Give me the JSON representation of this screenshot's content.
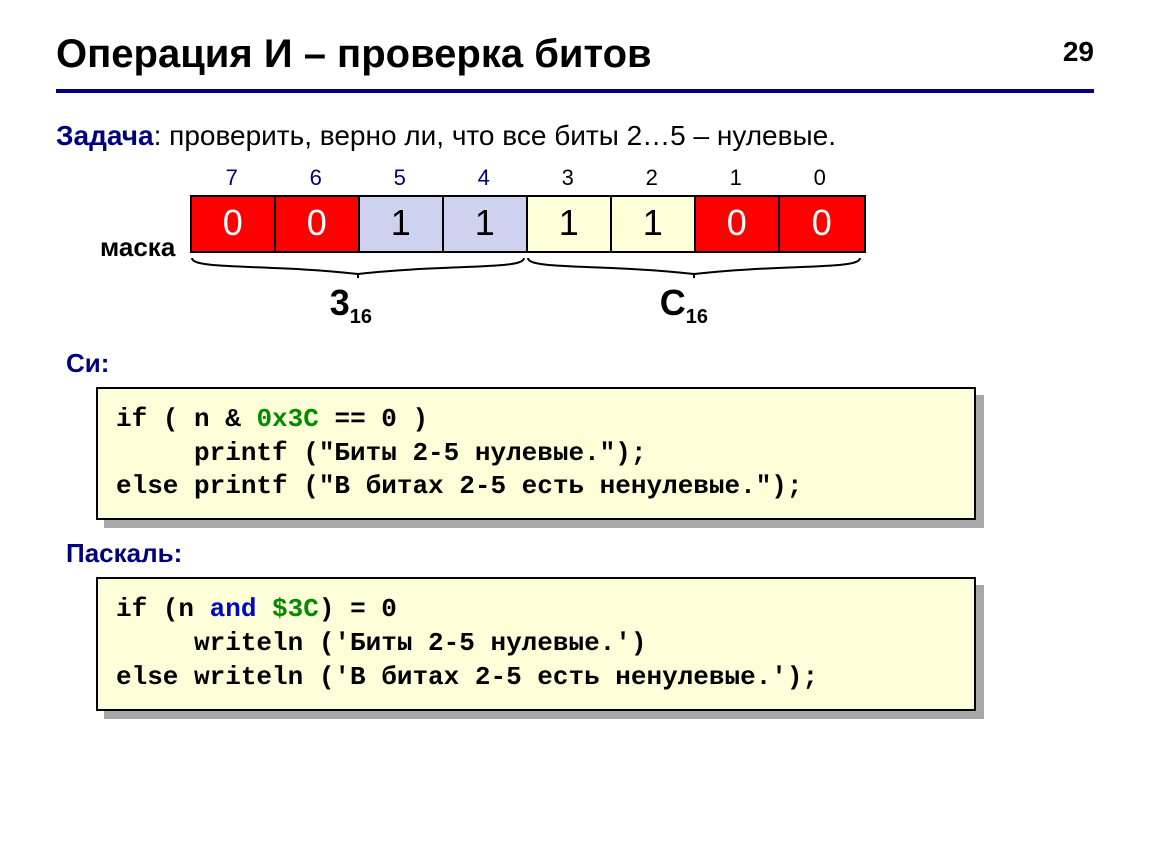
{
  "page_number": "29",
  "title": "Операция И – проверка битов",
  "task_label": "Задача",
  "task_text": ": проверить, верно ли, что все биты 2…5 – нулевые.",
  "mask_label": "маска",
  "bit_indices": [
    "7",
    "6",
    "5",
    "4",
    "3",
    "2",
    "1",
    "0"
  ],
  "bit_index_blue_count": 4,
  "mask_bits": [
    {
      "v": "0",
      "c": "red"
    },
    {
      "v": "0",
      "c": "red"
    },
    {
      "v": "1",
      "c": "blue"
    },
    {
      "v": "1",
      "c": "blue"
    },
    {
      "v": "1",
      "c": "yel"
    },
    {
      "v": "1",
      "c": "yel"
    },
    {
      "v": "0",
      "c": "red"
    },
    {
      "v": "0",
      "c": "red"
    }
  ],
  "hex_left": {
    "d": "3",
    "b": "16"
  },
  "hex_right": {
    "d": "C",
    "b": "16"
  },
  "lang_c": "Си:",
  "lang_p": "Паскаль:",
  "code_c": {
    "l1a": "if ( n & ",
    "l1b": "0x3C",
    "l1c": " == 0 )",
    "l2": "     printf (\"Биты 2-5 нулевые.\");",
    "l3": "else printf (\"В битах 2-5 есть ненулевые.\");"
  },
  "code_p": {
    "l1a": "if (n ",
    "l1b": "and",
    "l1c": " ",
    "l1d": "$3C",
    "l1e": ") = 0",
    "l2": "     writeln ('Биты 2-5 нулевые.')",
    "l3": "else writeln ('В битах 2-5 есть ненулевые.');"
  }
}
